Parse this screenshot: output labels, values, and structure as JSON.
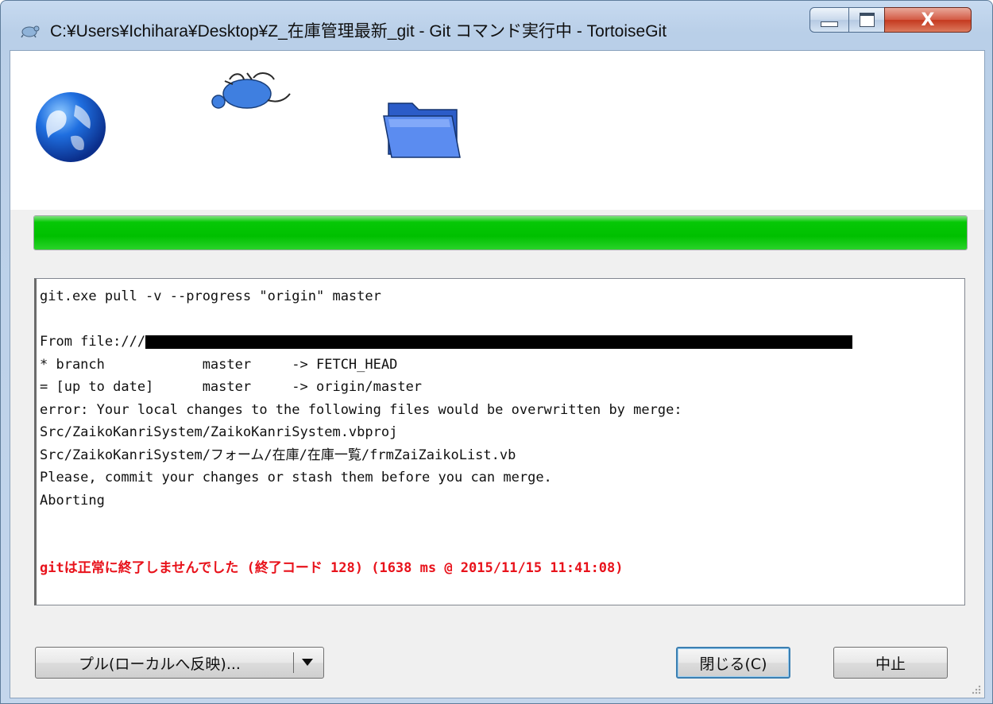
{
  "window": {
    "title": "C:¥Users¥Ichihara¥Desktop¥Z_在庫管理最新_git - Git コマンド実行中 - TortoiseGit",
    "app_icon": "tortoisegit-icon",
    "caption_icons": [
      "minimize-icon",
      "maximize-icon",
      "close-icon"
    ]
  },
  "animation": {
    "icons": [
      "globe-icon",
      "turtle-icon",
      "folder-icon"
    ]
  },
  "progress": {
    "percent": 100,
    "color": "#00c000"
  },
  "log": {
    "lines": [
      "git.exe pull -v --progress \"origin\" master",
      "",
      "From file:///",
      "* branch            master     -> FETCH_HEAD",
      "= [up to date]      master     -> origin/master",
      "error: Your local changes to the following files would be overwritten by merge:",
      "Src/ZaikoKanriSystem/ZaikoKanriSystem.vbproj",
      "Src/ZaikoKanriSystem/フォーム/在庫/在庫一覧/frmZaiZaikoList.vb",
      "Please, commit your changes or stash them before you can merge.",
      "Aborting",
      "",
      "",
      "gitは正常に終了しませんでした (終了コード 128) (1638 ms @ 2015/11/15 11:41:08)"
    ],
    "error_color": "#e8121b"
  },
  "buttons": {
    "pull_label": "プル(ローカルへ反映)...",
    "close_label": "閉じる(C)",
    "cancel_label": "中止"
  }
}
